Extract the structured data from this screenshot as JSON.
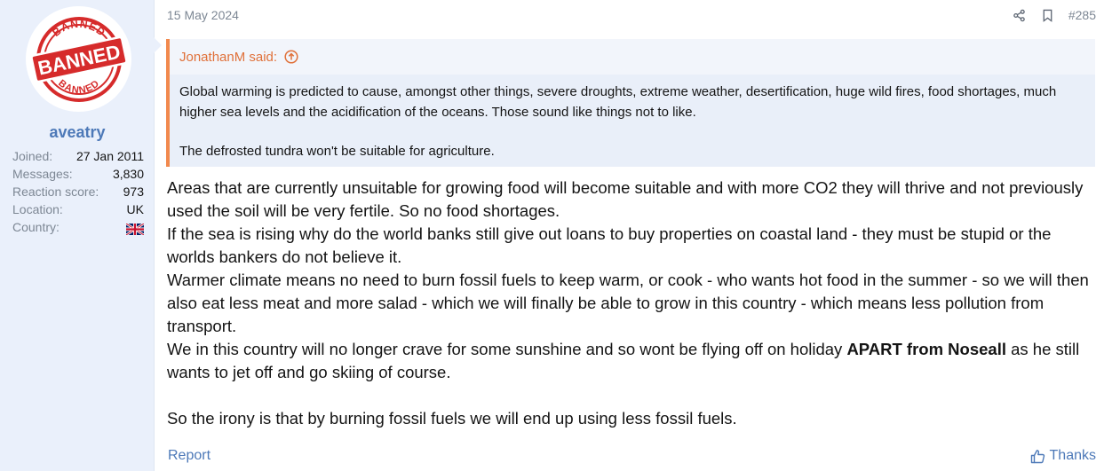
{
  "user": {
    "avatar_icon": "banned-stamp-icon",
    "avatar_stamp": {
      "top": "BANNED",
      "middle": "BANNED",
      "bottom": "BANNED"
    },
    "name": "aveatry",
    "stats": [
      {
        "label": "Joined:",
        "value": "27 Jan 2011"
      },
      {
        "label": "Messages:",
        "value": "3,830"
      },
      {
        "label": "Reaction score:",
        "value": "973"
      },
      {
        "label": "Location:",
        "value": "UK"
      },
      {
        "label": "Country:",
        "value": "",
        "icon": "uk-flag-icon"
      }
    ]
  },
  "post": {
    "date": "15 May 2024",
    "number": "#285",
    "header_icons": [
      "share-icon",
      "bookmark-icon"
    ],
    "quote": {
      "author_line": "JonathanM said:",
      "paragraphs": [
        "Global warming is predicted to cause, amongst other things, severe droughts, extreme weather, desertification, huge wild fires, food shortages, much higher sea levels and the acidification of the oceans. Those sound like things not to like.",
        "The defrosted tundra won't be suitable for agriculture."
      ]
    },
    "body": {
      "lines": [
        "Areas that are currently unsuitable for growing food will become suitable and with more CO2 they will thrive and not previously used the soil will be very fertile. So no food shortages.",
        "If the sea is rising why do the world banks still give out loans to buy properties on coastal land - they must be stupid or the worlds bankers do not believe it.",
        "Warmer climate means no need to burn fossil fuels to keep warm, or cook - who wants hot food in the summer - so we will then also eat less meat and more salad - which we will finally be able to grow in this country - which means less pollution from transport."
      ],
      "noseall_pre": "We in this country will no longer crave for some sunshine and so wont be flying off on holiday ",
      "noseall_bold": "APART from Noseall",
      "noseall_post": " as he still wants to jet off and go skiing of course.",
      "closing": "So the irony is that by burning fossil fuels we will end up using less fossil fuels."
    },
    "footer": {
      "report_label": "Report",
      "thanks_label": "Thanks"
    }
  },
  "colors": {
    "sidebar_bg": "#eaf0fb",
    "link": "#4d79b8",
    "quote_border": "#f2894d",
    "quote_author": "#e0713a",
    "stamp_red": "#d62b2b"
  }
}
